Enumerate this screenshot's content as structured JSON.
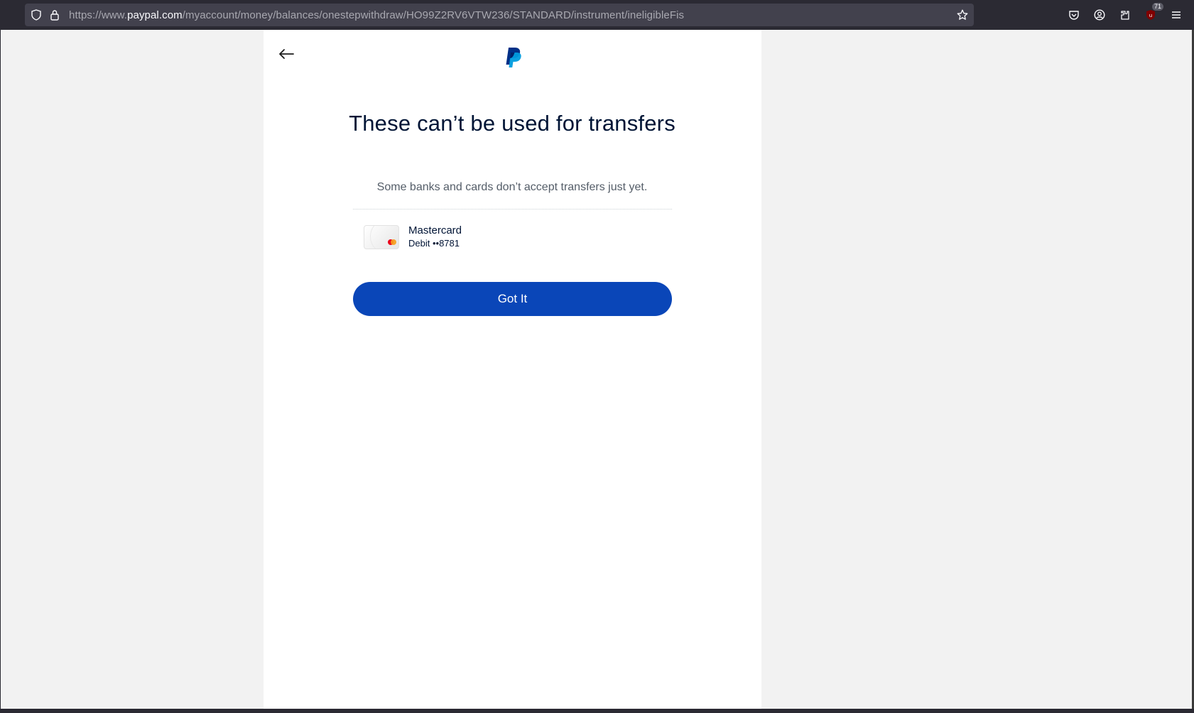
{
  "browser": {
    "url_prefix": "https://www.",
    "url_host": "paypal.com",
    "url_path": "/myaccount/money/balances/onestepwithdraw/HO99Z2RV6VTW236/STANDARD/instrument/ineligibleFis",
    "extension_badge": "71"
  },
  "page": {
    "title": "These can’t be used for transfers",
    "subtitle": "Some banks and cards don’t accept transfers just yet.",
    "card": {
      "name": "Mastercard",
      "detail": "Debit ••8781"
    },
    "button_label": "Got It"
  },
  "colors": {
    "button": "#0a46b8",
    "title": "#001435",
    "logo_dark": "#003087",
    "logo_light": "#009cde"
  },
  "icons": [
    "shield-icon",
    "lock-icon",
    "star-icon",
    "pocket-icon",
    "account-icon",
    "extensions-icon",
    "ublock-icon",
    "menu-icon",
    "back-arrow-icon",
    "paypal-logo",
    "mastercard-icon"
  ]
}
